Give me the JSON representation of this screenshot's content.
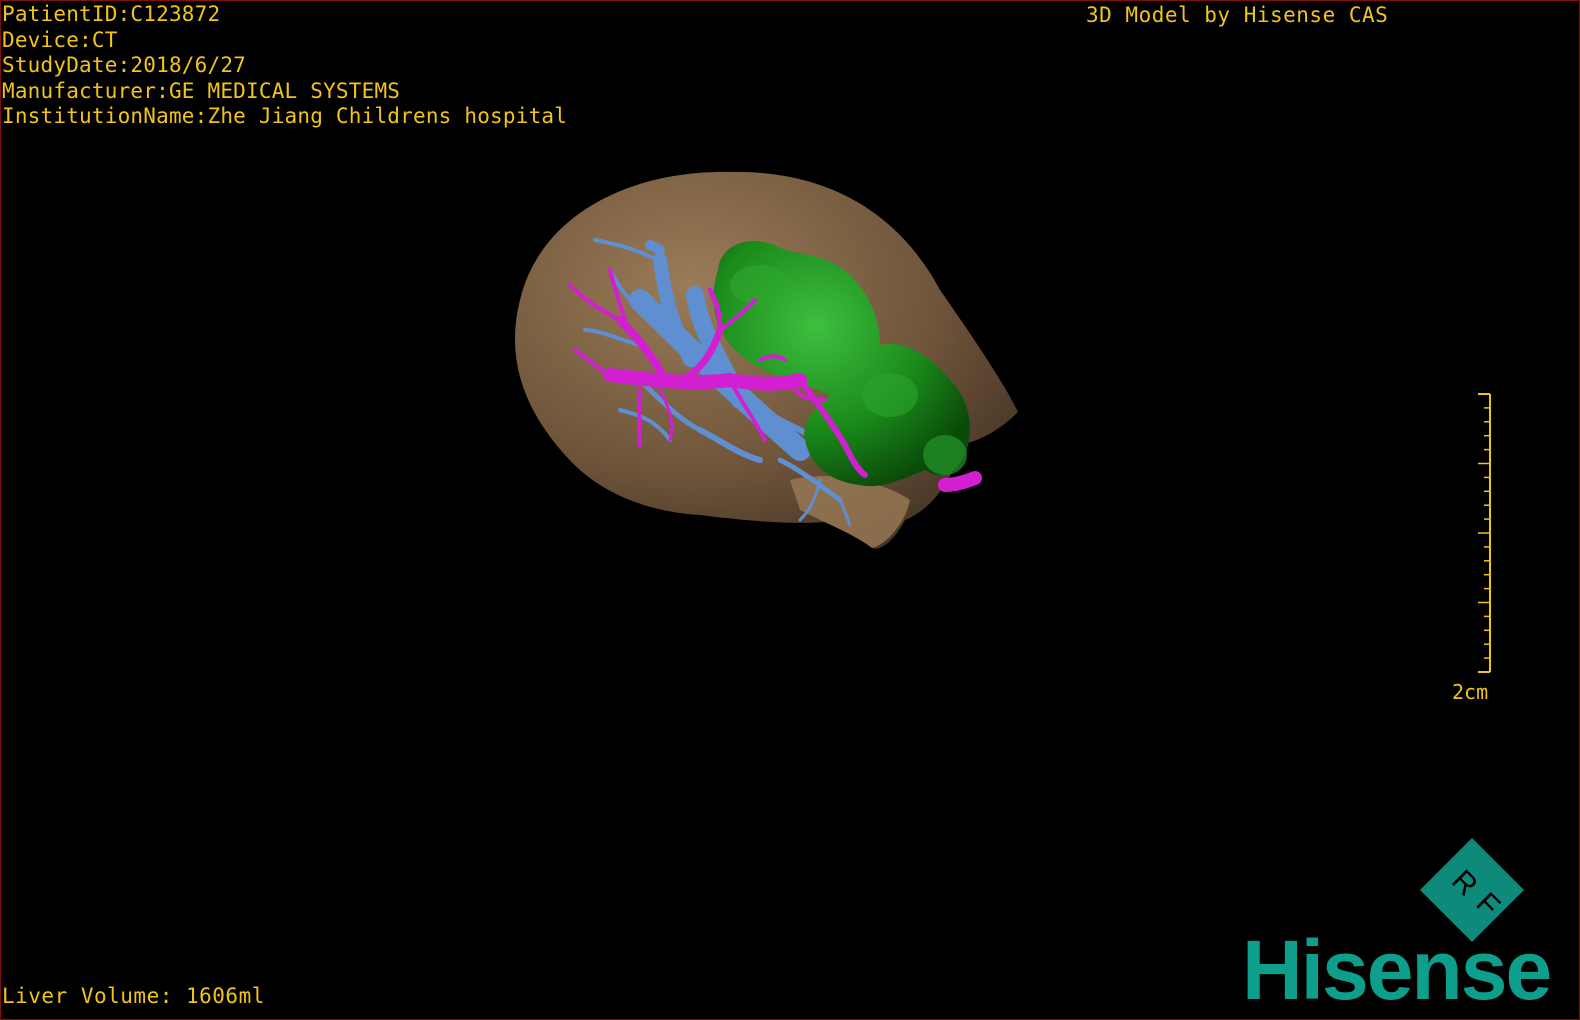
{
  "header": {
    "patient_id": "PatientID:C123872",
    "device": "Device:CT",
    "study_date": "StudyDate:2018/6/27",
    "manufacturer": "Manufacturer:GE MEDICAL SYSTEMS",
    "institution": "InstitutionName:Zhe Jiang Childrens hospital"
  },
  "credit": "3D Model by Hisense CAS",
  "footer": {
    "liver_volume": "Liver Volume: 1606ml"
  },
  "scale": {
    "label": "2cm"
  },
  "orientation_cube": {
    "label_1": "R",
    "label_2": "F"
  },
  "brand": {
    "logo_text": "Hisense"
  },
  "colors": {
    "overlay_text": "#f0c419",
    "liver": "#8a6a48",
    "tumor": "#1f8f1f",
    "portal_vein": "#d21fd2",
    "hepatic_vein": "#5f8fd0",
    "brand": "#0e9e8c"
  }
}
